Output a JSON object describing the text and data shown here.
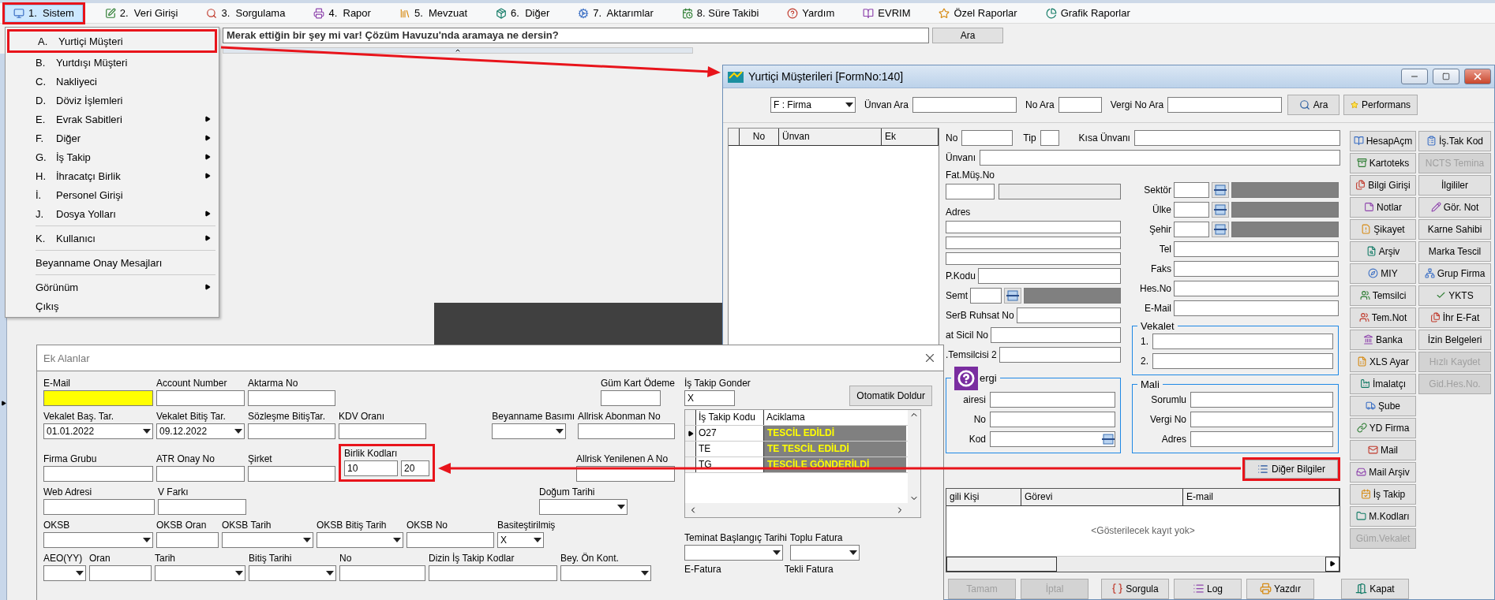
{
  "menu_bar": {
    "items": [
      {
        "label": "1.  Sistem",
        "selected": true,
        "highlighted": true
      },
      {
        "label": "2.  Veri Girişi",
        "selected": false,
        "highlighted": false
      },
      {
        "label": "3.  Sorgulama",
        "selected": false,
        "highlighted": false
      },
      {
        "label": "4.  Rapor",
        "selected": false,
        "highlighted": false
      },
      {
        "label": "5.  Mevzuat",
        "selected": false,
        "highlighted": false
      },
      {
        "label": "6.  Diğer",
        "selected": false,
        "highlighted": false
      },
      {
        "label": "7.  Aktarımlar",
        "selected": false,
        "highlighted": false
      },
      {
        "label": "8. Süre Takibi",
        "selected": false,
        "highlighted": false
      },
      {
        "label": "Yardım",
        "selected": false,
        "highlighted": false
      },
      {
        "label": "EVRIM",
        "selected": false,
        "highlighted": false
      },
      {
        "label": "Özel Raporlar",
        "selected": false,
        "highlighted": false
      },
      {
        "label": "Grafik Raporlar",
        "selected": false,
        "highlighted": false
      }
    ]
  },
  "search": {
    "value": "Merak ettiğin bir şey mi var! Çözüm Havuzu'nda aramaya ne dersin?",
    "button": "Ara"
  },
  "menu": {
    "items": [
      {
        "kind": "item",
        "key": "A.",
        "label": "Yurtiçi Müşteri",
        "submenu": false,
        "highlighted": true
      },
      {
        "kind": "item",
        "key": "B.",
        "label": "Yurtdışı Müşteri",
        "submenu": false,
        "highlighted": false
      },
      {
        "kind": "item",
        "key": "C.",
        "label": "Nakliyeci",
        "submenu": false,
        "highlighted": false
      },
      {
        "kind": "item",
        "key": "D.",
        "label": "Döviz İşlemleri",
        "submenu": false,
        "highlighted": false
      },
      {
        "kind": "item",
        "key": "E.",
        "label": "Evrak Sabitleri",
        "submenu": true,
        "highlighted": false
      },
      {
        "kind": "item",
        "key": "F.",
        "label": "Diğer",
        "submenu": true,
        "highlighted": false
      },
      {
        "kind": "item",
        "key": "G.",
        "label": "İş Takip",
        "submenu": true,
        "highlighted": false
      },
      {
        "kind": "item",
        "key": "H.",
        "label": "İhracatçı Birlik",
        "submenu": true,
        "highlighted": false
      },
      {
        "kind": "item",
        "key": "İ.",
        "label": "Personel Girişi",
        "submenu": false,
        "highlighted": false
      },
      {
        "kind": "item",
        "key": "J.",
        "label": "Dosya Yolları",
        "submenu": true,
        "highlighted": false
      },
      {
        "kind": "separator"
      },
      {
        "kind": "item",
        "key": "K.",
        "label": "Kullanıcı",
        "submenu": true,
        "highlighted": false
      },
      {
        "kind": "separator"
      },
      {
        "kind": "item",
        "label": "Beyanname Onay Mesajları",
        "submenu": false,
        "highlighted": false
      },
      {
        "kind": "separator"
      },
      {
        "kind": "item",
        "label": "Görünüm",
        "submenu": true,
        "highlighted": false
      },
      {
        "kind": "item",
        "label": "Çıkış",
        "submenu": false,
        "highlighted": false
      }
    ]
  },
  "customer_window": {
    "title": "Yurtiçi Müşterileri [FormNo:140]",
    "filter": {
      "type": "F : Firma",
      "fields": [
        {
          "label": "Ünvan Ara"
        },
        {
          "label": "No Ara"
        },
        {
          "label": "Vergi No Ara"
        }
      ],
      "buttons": [
        {
          "label": "Ara"
        },
        {
          "label": "Performans"
        }
      ]
    },
    "list": {
      "columns": [
        "No",
        "Ünvan",
        "Ek"
      ]
    },
    "form": {
      "top_row": [
        {
          "label": "No"
        },
        {
          "label": "Tip"
        },
        {
          "label": "Kısa Ünvanı"
        }
      ],
      "title_field": {
        "label": "Ünvanı"
      },
      "invoice_label": "Fat.Müş.No",
      "address_label": "Adres",
      "left_fields": [
        {
          "label": "P.Kodu",
          "kind": "text"
        },
        {
          "label": "Semt",
          "kind": "lookup"
        },
        {
          "label": "SerB Ruhsat No",
          "kind": "text"
        },
        {
          "label": "at Sicil No",
          "kind": "text"
        },
        {
          "label": ".Temsilcisi 2",
          "kind": "text"
        }
      ],
      "tax_group": {
        "title": "ergi",
        "fields": [
          {
            "label": "airesi",
            "kind": "text"
          },
          {
            "label": "No",
            "kind": "text"
          },
          {
            "label": "Kod",
            "kind": "lookup_short"
          }
        ]
      },
      "right_fields": [
        {
          "label": "Sektör",
          "kind": "lookup"
        },
        {
          "label": "Ülke",
          "kind": "lookup"
        },
        {
          "label": "Şehir",
          "kind": "lookup"
        },
        {
          "label": "Tel",
          "kind": "text"
        },
        {
          "label": "Faks",
          "kind": "text"
        },
        {
          "label": "Hes.No",
          "kind": "text"
        },
        {
          "label": "E-Mail",
          "kind": "text"
        }
      ],
      "proxy_group": {
        "title": "Vekalet",
        "fields": [
          {
            "label": "1."
          },
          {
            "label": "2."
          }
        ]
      },
      "finance_group": {
        "title": "Mali",
        "fields": [
          {
            "label": "Sorumlu"
          },
          {
            "label": "Vergi No"
          },
          {
            "label": "Adres"
          }
        ]
      },
      "more_button": {
        "label": "Diğer Bilgiler",
        "highlighted": true
      }
    },
    "contacts": {
      "columns": [
        "gili Kişi",
        "Görevi",
        "E-mail"
      ],
      "empty_text": "<Gösterilecek kayıt yok>"
    },
    "side_buttons": {
      "column_1": [
        {
          "label": "HesapAçm",
          "disabled": false
        },
        {
          "label": "Kartoteks",
          "disabled": false
        },
        {
          "label": "Bilgi Girişi",
          "disabled": false
        },
        {
          "label": "Notlar",
          "disabled": false
        },
        {
          "label": "Şikayet",
          "disabled": false
        },
        {
          "label": "Arşiv",
          "disabled": false
        },
        {
          "label": "MIY",
          "disabled": false
        },
        {
          "label": "Temsilci",
          "disabled": false
        },
        {
          "label": "Tem.Not",
          "disabled": false
        },
        {
          "label": "Banka",
          "disabled": false
        },
        {
          "label": "XLS Ayar",
          "disabled": false
        },
        {
          "label": "İmalatçı",
          "disabled": false
        },
        {
          "label": "Şube",
          "disabled": false
        },
        {
          "label": "YD Firma",
          "disabled": false
        },
        {
          "label": "Mail",
          "disabled": false
        },
        {
          "label": "Mail Arşiv",
          "disabled": false
        },
        {
          "label": "İş Takip",
          "disabled": false
        },
        {
          "label": "M.Kodları",
          "disabled": false
        },
        {
          "label": "Güm.Vekalet",
          "disabled": true
        }
      ],
      "column_2": [
        {
          "label": "İş.Tak Kod",
          "disabled": false
        },
        {
          "label": "NCTS Temina",
          "disabled": true
        },
        {
          "label": "İlgililer",
          "disabled": false
        },
        {
          "label": "Gör. Not",
          "disabled": false
        },
        {
          "label": "Karne Sahibi",
          "disabled": false
        },
        {
          "label": "Marka Tescil",
          "disabled": false
        },
        {
          "label": "Grup Firma",
          "disabled": false
        },
        {
          "label": "YKTS",
          "disabled": false
        },
        {
          "label": "İhr E-Fat",
          "disabled": false
        },
        {
          "label": "İzin Belgeleri",
          "disabled": false
        },
        {
          "label": "Hızlı Kaydet",
          "disabled": true
        },
        {
          "label": "Gid.Hes.No.",
          "disabled": true
        }
      ]
    },
    "bottom_buttons": [
      {
        "label": "Tamam",
        "disabled": true
      },
      {
        "label": "İptal",
        "disabled": true
      },
      {
        "label": "Sorgula",
        "disabled": false
      },
      {
        "label": "Log",
        "disabled": false
      },
      {
        "label": "Yazdır",
        "disabled": false
      },
      {
        "label": "Kapat",
        "disabled": false
      }
    ]
  },
  "extra_window": {
    "title": "Ek Alanlar",
    "rows": [
      {
        "left": [
          {
            "label": "E-Mail",
            "kind": "highlight"
          },
          {
            "label": "Account Number",
            "kind": "text"
          },
          {
            "label": "Aktarma No",
            "kind": "text"
          }
        ],
        "middle": [
          {
            "label": "Güm Kart Ödeme",
            "kind": "text"
          }
        ]
      },
      {
        "left": [
          {
            "label": "Vekalet Baş. Tar.",
            "kind": "combo",
            "value": "01.01.2022"
          },
          {
            "label": "Vekalet Bitiş Tar.",
            "kind": "combo",
            "value": "09.12.2022"
          },
          {
            "label": "Sözleşme BitişTar.",
            "kind": "text"
          },
          {
            "label": "KDV Oranı",
            "kind": "text"
          }
        ],
        "middle": [
          {
            "label": "Beyanname Basımı",
            "kind": "combo"
          },
          {
            "label": "Allrisk Abonman No",
            "kind": "text"
          }
        ]
      },
      {
        "left": [
          {
            "label": "Firma Grubu",
            "kind": "text"
          },
          {
            "label": "ATR Onay No",
            "kind": "text"
          },
          {
            "label": "Şirket",
            "kind": "text"
          },
          {
            "label": "Birlik Kodları",
            "kind": "pair",
            "values": [
              "10",
              "20"
            ],
            "highlighted": true
          }
        ],
        "middle": [
          {
            "label": "Allrisk Yenilenen A No",
            "kind": "text"
          }
        ]
      },
      {
        "left": [
          {
            "label": "Web Adresi",
            "kind": "text"
          },
          {
            "label": "V Farkı",
            "kind": "text"
          }
        ],
        "middle": [
          {
            "label": "Doğum Tarihi",
            "kind": "combo"
          }
        ]
      },
      {
        "left": [
          {
            "label": "OKSB",
            "kind": "combo"
          },
          {
            "label": "OKSB Oran",
            "kind": "text"
          },
          {
            "label": "OKSB Tarih",
            "kind": "combo"
          },
          {
            "label": "OKSB Bitiş Tarih",
            "kind": "combo"
          },
          {
            "label": "OKSB No",
            "kind": "text"
          },
          {
            "label": "Basiteştirilmiş",
            "kind": "combo",
            "value": "X"
          }
        ],
        "middle": []
      },
      {
        "left": [
          {
            "label": "AEO(YY)",
            "kind": "combo"
          },
          {
            "label": "Oran",
            "kind": "text"
          },
          {
            "label": "Tarih",
            "kind": "combo"
          },
          {
            "label": "Bitiş Tarihi",
            "kind": "combo"
          },
          {
            "label": "No",
            "kind": "text"
          },
          {
            "label": "Dizin İş Takip Kodlar",
            "kind": "text"
          },
          {
            "label": "Bey. Ön Kont.",
            "kind": "combo"
          }
        ],
        "middle": []
      }
    ],
    "follow_up": {
      "label": "İş Takip Gonder",
      "value": "X"
    },
    "autofill_button": "Otomatik Doldur",
    "codes_table": {
      "columns": [
        "İş Takip Kodu",
        "Aciklama"
      ],
      "rows": [
        {
          "code": "O27",
          "description": "TESCİL EDİLDİ",
          "selected": true
        },
        {
          "code": "TE",
          "description": "TE TESCİL EDİLDİ",
          "selected": false
        },
        {
          "code": "TG",
          "description": "TESCİLE GÖNDERİLDİ",
          "selected": false
        }
      ]
    },
    "bottom_fields": [
      {
        "label": "Teminat Başlangıç Tarihi",
        "kind": "combo"
      },
      {
        "label": "Toplu Fatura",
        "kind": "combo"
      }
    ],
    "bottom_labels": [
      "E-Fatura",
      "Tekli Fatura"
    ]
  }
}
